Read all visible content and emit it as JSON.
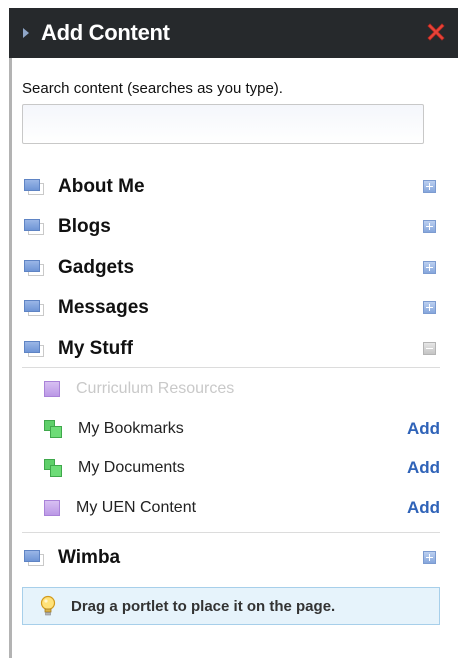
{
  "panel": {
    "title": "Add Content",
    "close_icon": "close-icon"
  },
  "search": {
    "label": "Search content (searches as you type).",
    "value": "",
    "placeholder": ""
  },
  "categories": [
    {
      "label": "About Me",
      "state": "collapsed"
    },
    {
      "label": "Blogs",
      "state": "collapsed"
    },
    {
      "label": "Gadgets",
      "state": "collapsed"
    },
    {
      "label": "Messages",
      "state": "collapsed"
    },
    {
      "label": "My Stuff",
      "state": "expanded"
    },
    {
      "label": "Wimba",
      "state": "collapsed"
    }
  ],
  "my_stuff_items": [
    {
      "label": "Curriculum Resources",
      "icon": "purple-square-icon",
      "disabled": true,
      "action": ""
    },
    {
      "label": "My Bookmarks",
      "icon": "green-squares-icon",
      "disabled": false,
      "action": "Add"
    },
    {
      "label": "My Documents",
      "icon": "green-squares-icon",
      "disabled": false,
      "action": "Add"
    },
    {
      "label": "My UEN Content",
      "icon": "purple-square-icon",
      "disabled": false,
      "action": "Add"
    }
  ],
  "tip": {
    "text": "Drag a portlet to place it on the page.",
    "icon": "lightbulb-icon"
  },
  "colors": {
    "header_bg": "#26292c",
    "close": "#e8443a",
    "link": "#2f63b8",
    "tip_bg": "#e6f3fb"
  }
}
